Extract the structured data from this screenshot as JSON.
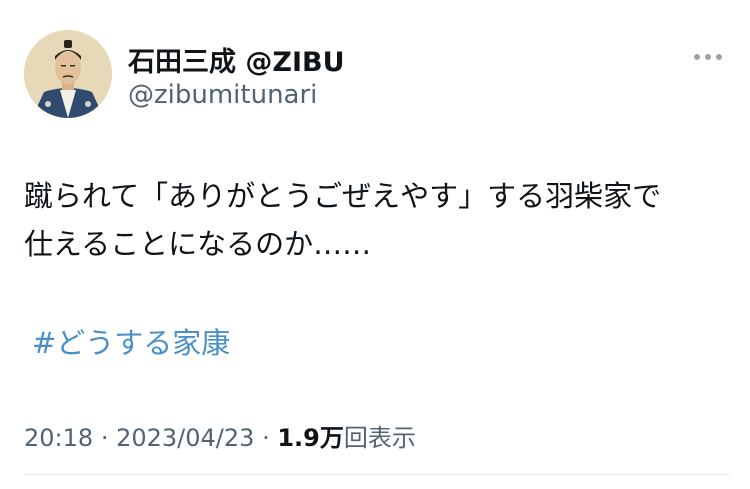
{
  "tweet": {
    "display_name": "石田三成 @ZIBU",
    "handle": "@zibumitunari",
    "text_lines": [
      "蹴られて「ありがとうごぜえやす」する羽柴家で",
      "仕えることになるのか……"
    ],
    "hashtag": "#どうする家康",
    "time": "20:18",
    "separator": "·",
    "date": "2023/04/23",
    "views_count": "1.9万",
    "views_label": "回表示"
  },
  "colors": {
    "text": "#0f1419",
    "secondary": "#536471",
    "link": "#4a90c8"
  },
  "icons": {
    "more": "more-horizontal-icon",
    "avatar": "samurai-portrait-avatar"
  }
}
